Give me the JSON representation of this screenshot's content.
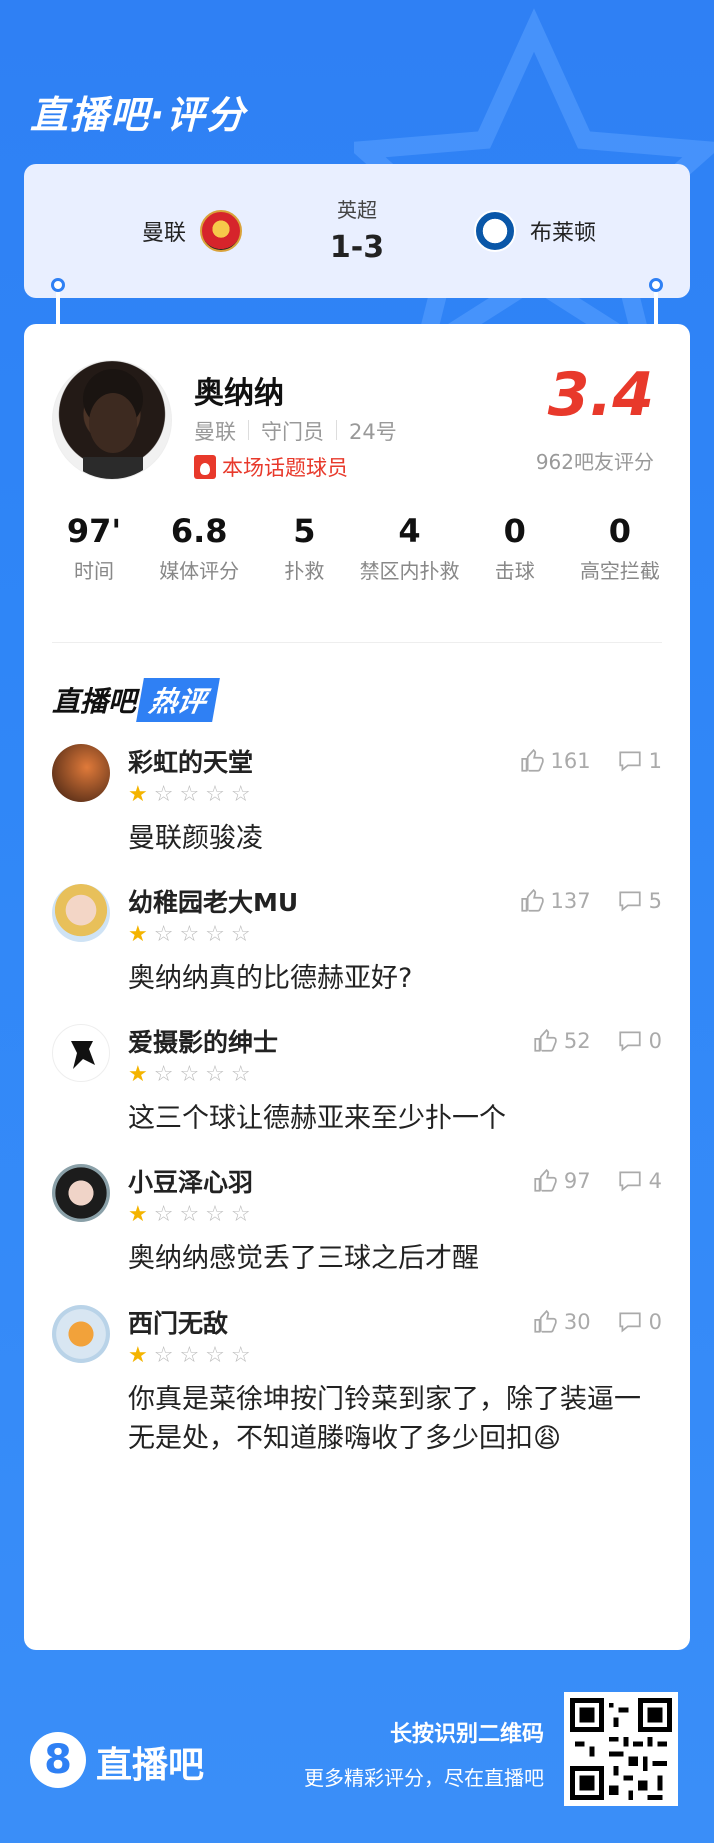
{
  "app_title": "直播吧·评分",
  "match": {
    "league": "英超",
    "score": "1-3",
    "home_team": "曼联",
    "away_team": "布莱顿"
  },
  "player": {
    "name": "奥纳纳",
    "team": "曼联",
    "position": "守门员",
    "number": "24号",
    "hot_tag": "本场话题球员",
    "rating": "3.4",
    "rating_count": "962吧友评分"
  },
  "stats": [
    {
      "value": "97'",
      "label": "时间"
    },
    {
      "value": "6.8",
      "label": "媒体评分"
    },
    {
      "value": "5",
      "label": "扑救"
    },
    {
      "value": "4",
      "label": "禁区内扑救"
    },
    {
      "value": "0",
      "label": "击球"
    },
    {
      "value": "0",
      "label": "高空拦截"
    }
  ],
  "section": {
    "title_a": "直播吧",
    "title_b": "热评"
  },
  "comments": [
    {
      "user": "彩虹的天堂",
      "likes": "161",
      "replies": "1",
      "stars": 1,
      "text": "曼联颜骏凌"
    },
    {
      "user": "幼稚园老大MU",
      "likes": "137",
      "replies": "5",
      "stars": 1,
      "text": "奥纳纳真的比德赫亚好?"
    },
    {
      "user": "爱摄影的绅士",
      "likes": "52",
      "replies": "0",
      "stars": 1,
      "text": "这三个球让德赫亚来至少扑一个"
    },
    {
      "user": "小豆泽心羽",
      "likes": "97",
      "replies": "4",
      "stars": 1,
      "text": "奥纳纳感觉丢了三球之后才醒"
    },
    {
      "user": "西门无敌",
      "likes": "30",
      "replies": "0",
      "stars": 1,
      "text": "你真是菜徐坤按门铃菜到家了，除了装逼一无是处，不知道滕嗨收了多少回扣😩"
    }
  ],
  "footer": {
    "logo_digit": "8",
    "brand": "直播吧",
    "cta_line1": "长按识别二维码",
    "cta_line2": "更多精彩评分，尽在直播吧"
  },
  "colors": {
    "accent": "#2f80f4",
    "rating": "#e8392b",
    "star": "#f4b400"
  }
}
